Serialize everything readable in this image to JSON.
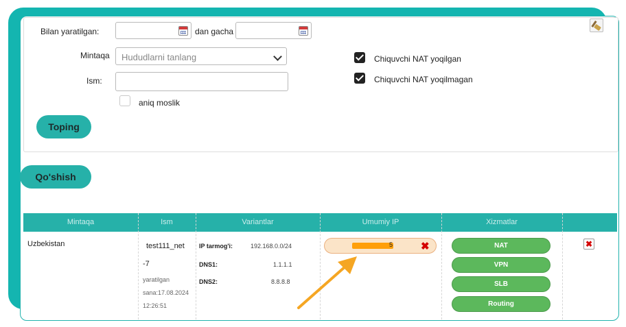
{
  "search": {
    "created_from_label": "Bilan yaratilgan:",
    "created_to_label": "dan gacha",
    "region_label": "Mintaqa",
    "region_placeholder": "Hududlarni tanlang",
    "name_label": "Ism:",
    "exact_match_label": "aniq moslik",
    "nat_enabled_label": "Chiquvchi NAT yoqilgan",
    "nat_disabled_label": "Chiquvchi NAT yoqilmagan",
    "nat_enabled_checked": true,
    "nat_disabled_checked": true,
    "exact_match_checked": false,
    "find_button": "Toping",
    "clear_icon": "broom-icon"
  },
  "add_button": "Qo'shish",
  "table": {
    "headers": [
      "Mintaqa",
      "Ism",
      "Variantlar",
      "Umumiy IP",
      "Xizmatlar",
      ""
    ],
    "rows": [
      {
        "region": "Uzbekistan",
        "name_line1": "test111_net",
        "name_line2": "-7",
        "created_line1": "yaratilgan",
        "created_line2": "sana:17.08.2024",
        "created_line3": "12:26:51",
        "ip_net_label": "IP tarmog'i:",
        "ip_net_value": "192.168.0.0/24",
        "dns1_label": "DNS1:",
        "dns1_value": "1.1.1.1",
        "dns2_label": "DNS2:",
        "dns2_value": "8.8.8.8",
        "public_ip_tail": "5",
        "services": [
          "NAT",
          "VPN",
          "SLB",
          "Routing"
        ]
      }
    ]
  },
  "colors": {
    "teal": "#26b1a9",
    "frame": "#14b5b0",
    "service_green": "#5cb85c",
    "annotation_arrow": "#f5a623",
    "delete_red": "#d40000"
  }
}
